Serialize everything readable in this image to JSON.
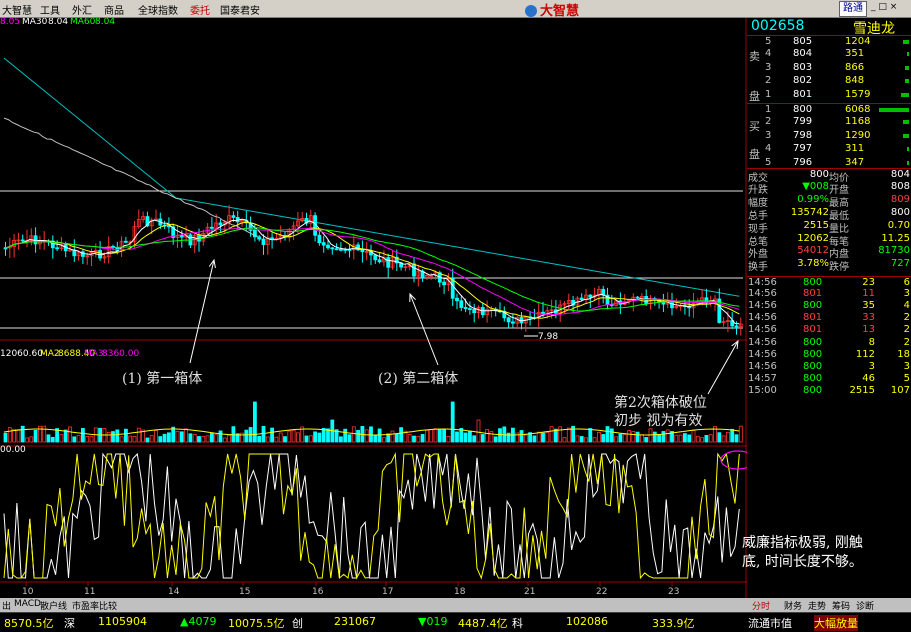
{
  "menu": [
    "大智慧",
    "工具",
    "外汇",
    "商品",
    "全球指数",
    "委托",
    "国泰君安"
  ],
  "logo": "大智慧",
  "luton": "路通",
  "window_controls": "_ □ ×",
  "colors": {
    "up": "#ff3232",
    "down": "#00ffff",
    "ma5": "#ffffff",
    "ma10": "#ffff00",
    "ma20": "#ff00ff",
    "ma30": "#00ff00",
    "ma60": "#00c0c0",
    "accent": "#ff0000"
  },
  "stock": {
    "code": "002658",
    "name": "雪迪龙"
  },
  "ma_legend": {
    "ma20": "8.05",
    "ma30_label": "MA30",
    "ma30": "8.04",
    "ma60_label": "MA60",
    "ma60": "8.04"
  },
  "vol_legend": {
    "v1": "12060.60",
    "ma2_label": "MA2",
    "ma2": "8688.40",
    "ma3_label": "MA3",
    "ma3": "8360.00"
  },
  "wr_legend": "00.00",
  "price_label": "7.98",
  "x_ticks": [
    "10",
    "11",
    "14",
    "15",
    "16",
    "17",
    "18",
    "21",
    "22",
    "23"
  ],
  "annotations": {
    "box1": "(1) 第一箱体",
    "box2": "(2) 第二箱体",
    "breakdown_line1": "第2次箱体破位",
    "breakdown_line2": "初步 视为有效",
    "wr_line1": "威廉指标极弱, 刚触",
    "wr_line2": "底, 时间长度不够。"
  },
  "order_book": {
    "sell_label": [
      "卖",
      "盘"
    ],
    "buy_label": [
      "买",
      "盘"
    ],
    "sell": [
      {
        "lvl": "5",
        "price": "805",
        "vol": "1204"
      },
      {
        "lvl": "4",
        "price": "804",
        "vol": "351"
      },
      {
        "lvl": "3",
        "price": "803",
        "vol": "866"
      },
      {
        "lvl": "2",
        "price": "802",
        "vol": "848"
      },
      {
        "lvl": "1",
        "price": "801",
        "vol": "1579"
      }
    ],
    "buy": [
      {
        "lvl": "1",
        "price": "800",
        "vol": "6068"
      },
      {
        "lvl": "2",
        "price": "799",
        "vol": "1168"
      },
      {
        "lvl": "3",
        "price": "798",
        "vol": "1290"
      },
      {
        "lvl": "4",
        "price": "797",
        "vol": "311"
      },
      {
        "lvl": "5",
        "price": "796",
        "vol": "347"
      }
    ]
  },
  "quote": [
    {
      "l1": "成交",
      "v1": "800",
      "l2": "均价",
      "v2": "804"
    },
    {
      "l1": "升跌",
      "v1": "▼008",
      "l2": "开盘",
      "v2": "808"
    },
    {
      "l1": "幅度",
      "v1": "0.99%",
      "l2": "最高",
      "v2": "809"
    },
    {
      "l1": "总手",
      "v1": "135742",
      "l2": "最低",
      "v2": "800"
    },
    {
      "l1": "现手",
      "v1": "2515",
      "l2": "量比",
      "v2": "0.70"
    },
    {
      "l1": "总笔",
      "v1": "12062",
      "l2": "每笔",
      "v2": "11.25"
    },
    {
      "l1": "外盘",
      "v1": "54012",
      "l2": "内盘",
      "v2": "81730"
    },
    {
      "l1": "换手",
      "v1": "3.78%",
      "l2": "跌停",
      "v2": "727"
    }
  ],
  "ticks": [
    {
      "t": "14:56",
      "p": "800",
      "v": "23",
      "n": "6"
    },
    {
      "t": "14:56",
      "p": "801",
      "v": "11",
      "n": "3"
    },
    {
      "t": "14:56",
      "p": "800",
      "v": "35",
      "n": "4"
    },
    {
      "t": "14:56",
      "p": "801",
      "v": "33",
      "n": "2"
    },
    {
      "t": "14:56",
      "p": "801",
      "v": "13",
      "n": "2"
    },
    {
      "t": "14:56",
      "p": "800",
      "v": "8",
      "n": "2"
    },
    {
      "t": "14:56",
      "p": "800",
      "v": "112",
      "n": "18"
    },
    {
      "t": "14:56",
      "p": "800",
      "v": "3",
      "n": "3"
    },
    {
      "t": "14:57",
      "p": "800",
      "v": "46",
      "n": "5"
    },
    {
      "t": "15:00",
      "p": "800",
      "v": "2515",
      "n": "107"
    }
  ],
  "bottom_tabs": [
    "出",
    "MACD",
    "散户线",
    "市盈率比较"
  ],
  "side_tabs": [
    "分时",
    "财务",
    "走势",
    "筹码",
    "诊断"
  ],
  "ticker": [
    "8570.5亿",
    "深",
    "1105904",
    "▲4079",
    "10075.5亿",
    "创",
    "231067",
    "▼019",
    "4487.4亿",
    "科",
    "102086",
    "333.9亿",
    "流通市值",
    "大幅放量"
  ]
}
